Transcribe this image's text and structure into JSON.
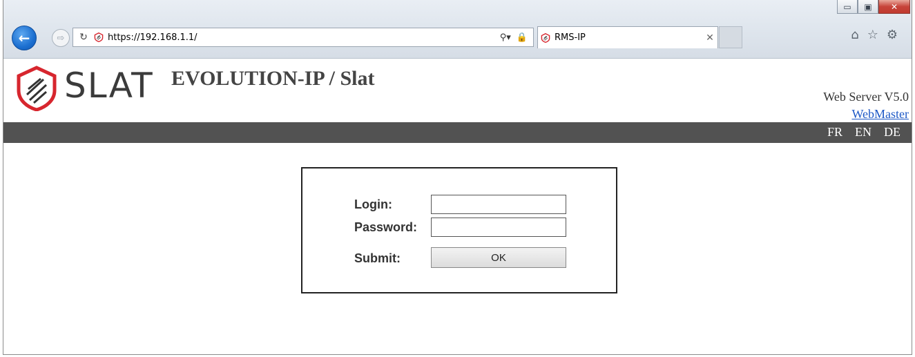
{
  "browser": {
    "url": "https://192.168.1.1/",
    "tab_title": "RMS-IP",
    "icons": [
      "back-icon",
      "forward-icon",
      "refresh-icon",
      "search-icon",
      "lock-icon",
      "close-icon",
      "home-icon",
      "star-icon",
      "gear-icon"
    ],
    "window_controls": [
      "minimize",
      "maximize",
      "close"
    ]
  },
  "header": {
    "brand": "SLAT",
    "title": "EVOLUTION-IP / Slat",
    "version": "Web Server V5.0",
    "webmaster_link": "WebMaster"
  },
  "nav": {
    "languages": [
      "FR",
      "EN",
      "DE"
    ]
  },
  "login_form": {
    "login_label": "Login:",
    "password_label": "Password:",
    "submit_label": "Submit:",
    "ok_button": "OK",
    "login_value": "",
    "password_value": ""
  },
  "colors": {
    "navbar": "#525252",
    "brand_red": "#d7262e",
    "link": "#1d58c6"
  }
}
